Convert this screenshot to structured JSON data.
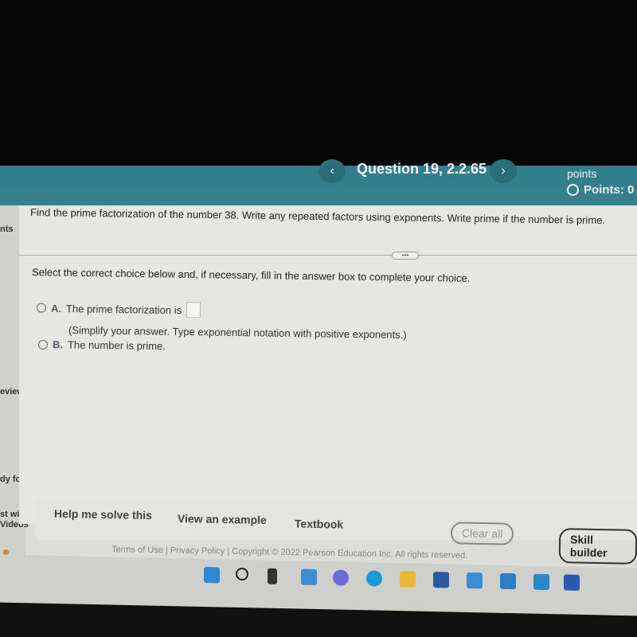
{
  "header": {
    "question_title": "Question 19, 2.2.65",
    "prev": "‹",
    "next": "›",
    "points_label": "points",
    "points_status": "Points: 0"
  },
  "sidebar": {
    "items": [
      "nts",
      "eview",
      "dy for t",
      "st with",
      "Videos"
    ]
  },
  "question": {
    "prompt": "Find the prime factorization of the number 38. Write any repeated factors using exponents. Write prime if the number is prime.",
    "more": "•••",
    "instruction": "Select the correct choice below and, if necessary, fill in the answer box to complete your choice.",
    "options": [
      {
        "letter": "A.",
        "text": "The prime factorization is",
        "hint": "(Simplify your answer. Type exponential notation with positive exponents.)"
      },
      {
        "letter": "B.",
        "text": "The number is prime."
      }
    ]
  },
  "toolbar": {
    "help": "Help me solve this",
    "example": "View an example",
    "textbook": "Textbook",
    "clear": "Clear all",
    "skill": "Skill builder"
  },
  "footer": "Terms of Use | Privacy Policy | Copyright © 2022 Pearson Education Inc. All rights reserved.",
  "taskbar": {
    "icons": [
      "windows-start",
      "search",
      "widgets",
      "task-view",
      "teams-chat",
      "edge",
      "file-explorer",
      "microsoft-store",
      "mail",
      "app",
      "app2",
      "word"
    ],
    "colors": {
      "header": "#37808c"
    }
  }
}
